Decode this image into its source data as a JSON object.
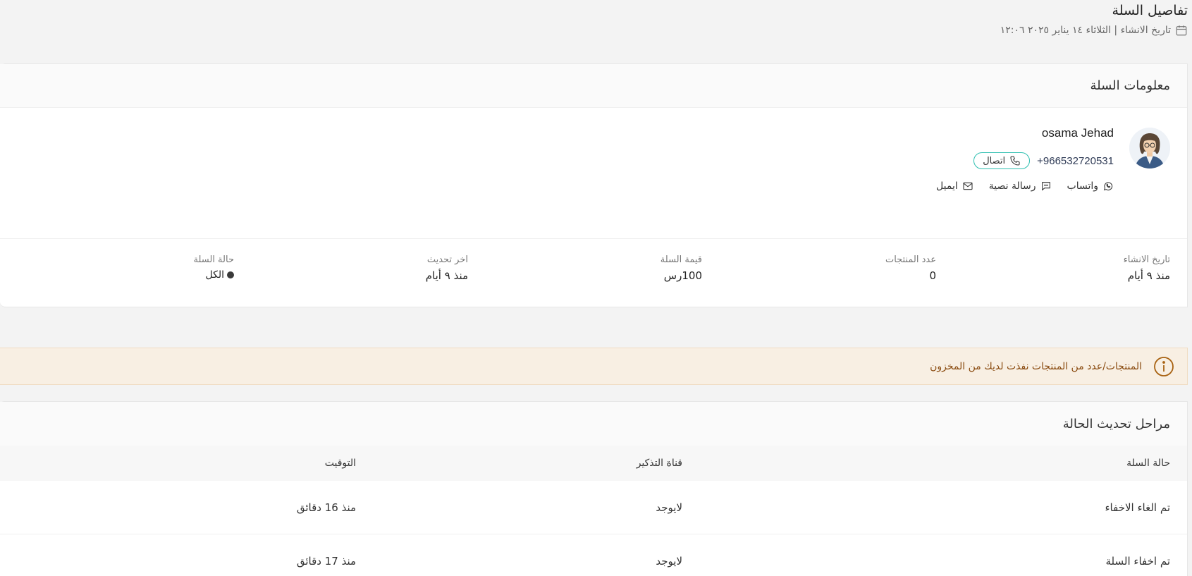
{
  "header": {
    "title": "تفاصيل السلة",
    "created_label": "تاريخ الانشاء | الثلاثاء ١٤ يناير ٢٠٢٥ ١٢:٠٦"
  },
  "cart_info": {
    "title": "معلومات السلة",
    "customer": {
      "name": "osama Jehad",
      "phone": "+966532720531",
      "call_label": "اتصال",
      "whatsapp_label": "واتساب",
      "sms_label": "رسالة نصية",
      "email_label": "ايميل"
    },
    "stats": [
      {
        "label": "تاريخ الانشاء",
        "value": "منذ ٩ أيام"
      },
      {
        "label": "عدد المنتجات",
        "value": "0"
      },
      {
        "label": "قيمة السلة",
        "value": "100رس"
      },
      {
        "label": "اخر تحديث",
        "value": "منذ ٩ أيام"
      },
      {
        "label": "حالة السلة",
        "value": "الكل"
      }
    ]
  },
  "alert": {
    "text": "المنتجات/عدد من المنتجات نفذت لديك من المخزون"
  },
  "status_stages": {
    "title": "مراحل تحديث الحالة",
    "columns": [
      "حالة السلة",
      "قناة التذكير",
      "التوقيت"
    ],
    "rows": [
      {
        "status": "تم الغاء الاخفاء",
        "channel": "لايوجد",
        "time": "منذ 16 دقائق"
      },
      {
        "status": "تم اخفاء السلة",
        "channel": "لايوجد",
        "time": "منذ 17 دقائق"
      }
    ]
  },
  "colors": {
    "accent": "#2dbfb0",
    "alert_bg": "#f8efe3",
    "alert_text": "#8a4b10"
  }
}
